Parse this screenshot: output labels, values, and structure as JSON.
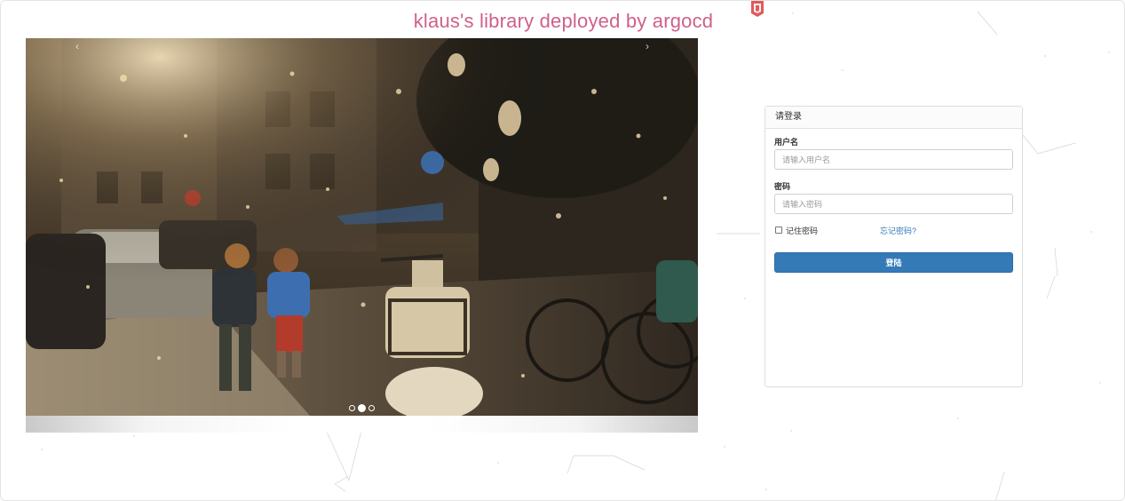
{
  "site": {
    "title": "klaus's library deployed by argocd"
  },
  "carousel": {
    "prev_glyph": "‹",
    "next_glyph": "›",
    "slide_count": 3,
    "active_index": 1
  },
  "login": {
    "heading": "请登录",
    "username_label": "用户名",
    "username_placeholder": "请输入用户名",
    "username_value": "",
    "password_label": "密码",
    "password_placeholder": "请输入密码",
    "password_value": "",
    "remember_label": "记住密码",
    "remember_checked": false,
    "forgot_link": "忘记密码?",
    "submit_label": "登陆"
  },
  "colors": {
    "title": "#d0608a",
    "primary_button": "#337ab7",
    "link": "#337ab7"
  },
  "icons": {
    "logo": "book-logo-icon"
  }
}
